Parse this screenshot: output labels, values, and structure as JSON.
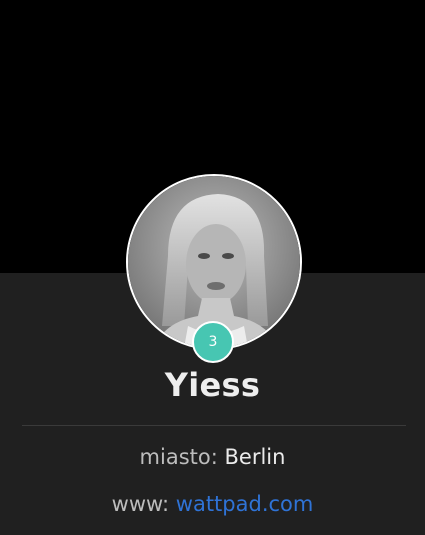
{
  "profile": {
    "name": "Yiess",
    "badge_count": "3",
    "avatar_icon": "user-photo",
    "details": {
      "city_label": "miasto:",
      "city_value": "Berlin",
      "www_label": "www:",
      "www_value": "wattpad.com"
    }
  },
  "colors": {
    "cover": "#000000",
    "background": "#202020",
    "badge": "#47c6b2",
    "link": "#2f73d6"
  }
}
